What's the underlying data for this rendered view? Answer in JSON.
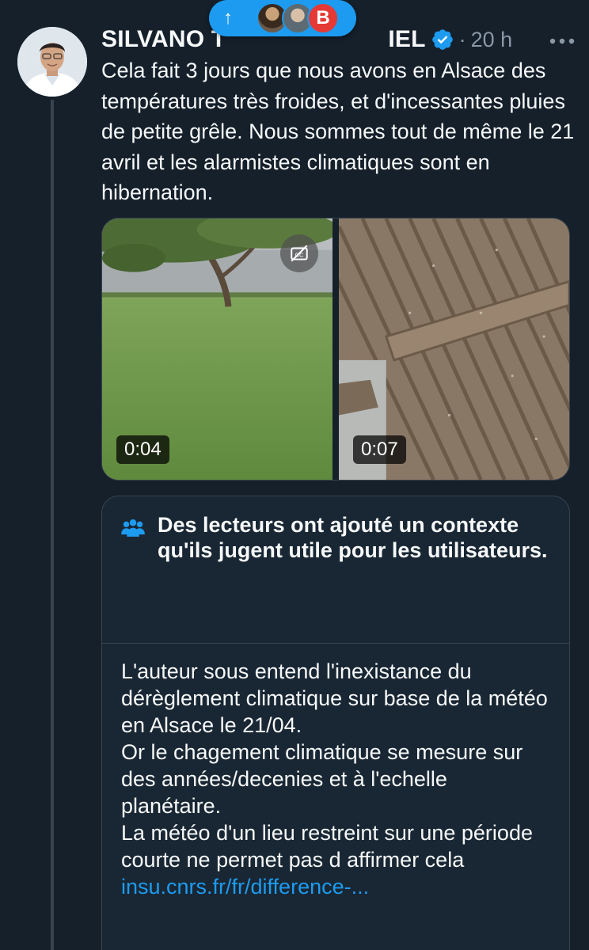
{
  "post": {
    "author_name_start": "SILVANO T",
    "author_name_end": "IEL",
    "time": "20 h",
    "separator": "·",
    "text": "Cela fait 3 jours que nous avons en Alsace des températures très froides, et d'incessantes pluies de petite grêle. Nous sommes tout de même le 21 avril et les alarmistes climatiques sont en hibernation."
  },
  "pill": {
    "arrow": "↑",
    "badge": "B"
  },
  "media": [
    {
      "duration": "0:04",
      "captions_icon": "cc-off-icon"
    },
    {
      "duration": "0:07"
    }
  ],
  "note": {
    "title": "Des lecteurs ont ajouté un contexte qu'ils jugent utile pour les utilisateurs.",
    "body": " L'auteur sous entend l'inexistance du dérèglement climatique sur base de la météo en Alsace le 21/04.\nOr le chagement climatique se mesure sur des années/decenies et à l'echelle planétaire.\nLa météo d'un lieu restreint sur une période courte ne permet pas d affirmer cela",
    "link": "insu.cnrs.fr/fr/difference-..."
  },
  "colors": {
    "background": "#15202b",
    "accent": "#1d9bf0",
    "secondary_text": "#8b98a5",
    "border": "#38444d"
  }
}
